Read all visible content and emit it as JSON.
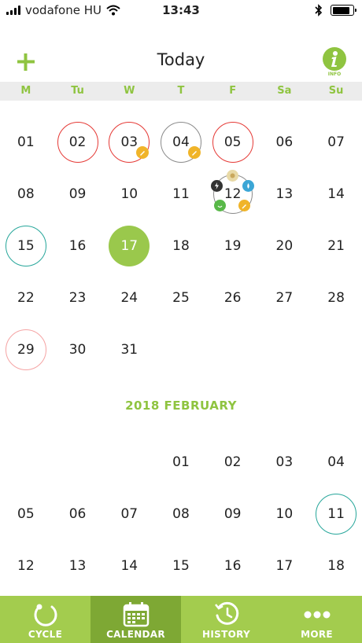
{
  "status_bar": {
    "carrier": "vodafone HU",
    "time": "13:43"
  },
  "header": {
    "title": "Today",
    "info_label": "INFO"
  },
  "weekdays": [
    "M",
    "Tu",
    "W",
    "T",
    "F",
    "Sa",
    "Su"
  ],
  "january": {
    "days": [
      "01",
      "02",
      "03",
      "04",
      "05",
      "06",
      "07",
      "08",
      "09",
      "10",
      "11",
      "12",
      "13",
      "14",
      "15",
      "16",
      "17",
      "18",
      "19",
      "20",
      "21",
      "22",
      "23",
      "24",
      "25",
      "26",
      "27",
      "28",
      "29",
      "30",
      "31"
    ]
  },
  "february": {
    "title": "2018 FEBRUARY",
    "days": [
      "01",
      "02",
      "03",
      "04",
      "05",
      "06",
      "07",
      "08",
      "09",
      "10",
      "11",
      "12",
      "13",
      "14",
      "15",
      "16",
      "17",
      "18"
    ]
  },
  "tabs": [
    {
      "label": "CYCLE",
      "icon": "cycle-icon"
    },
    {
      "label": "CALENDAR",
      "icon": "calendar-icon"
    },
    {
      "label": "HISTORY",
      "icon": "history-icon"
    },
    {
      "label": "MORE",
      "icon": "more-icon"
    }
  ],
  "colors": {
    "accent": "#8fc440",
    "period": "#e53935",
    "fertile": "#26a69a",
    "predicted": "#f5a3a3",
    "note": "#f0b429"
  },
  "active_tab": "CALENDAR"
}
